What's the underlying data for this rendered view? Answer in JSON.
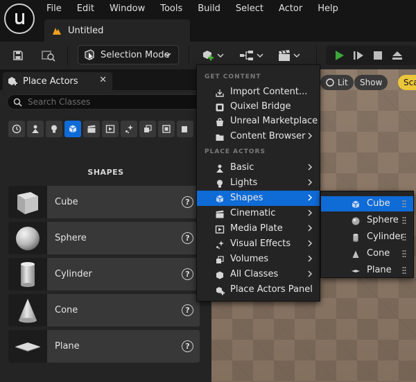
{
  "menubar": {
    "items": [
      "File",
      "Edit",
      "Window",
      "Tools",
      "Build",
      "Select",
      "Actor",
      "Help"
    ],
    "document_tab": "Untitled"
  },
  "toolbar": {
    "mode_label": "Selection Mode"
  },
  "viewport": {
    "lit_label": "Lit",
    "show_label": "Show",
    "scale_label": "Sca"
  },
  "place_actors": {
    "tab_label": "Place Actors",
    "search_placeholder": "Search Classes",
    "category_header": "SHAPES",
    "items": [
      {
        "label": "Cube",
        "icon": "cube-icon"
      },
      {
        "label": "Sphere",
        "icon": "sphere-icon"
      },
      {
        "label": "Cylinder",
        "icon": "cylinder-icon"
      },
      {
        "label": "Cone",
        "icon": "cone-icon"
      },
      {
        "label": "Plane",
        "icon": "plane-icon"
      }
    ]
  },
  "dropdown": {
    "get_content_header": "GET CONTENT",
    "place_actors_header": "PLACE ACTORS",
    "get_content": [
      "Import Content...",
      "Quixel Bridge",
      "Unreal Marketplace",
      "Content Browser"
    ],
    "place_actors": [
      "Basic",
      "Lights",
      "Shapes",
      "Cinematic",
      "Media Plate",
      "Visual Effects",
      "Volumes",
      "All Classes",
      "Place Actors Panel"
    ]
  },
  "submenu": {
    "items": [
      "Cube",
      "Sphere",
      "Cylinder",
      "Cone",
      "Plane"
    ]
  },
  "colors": {
    "accent": "#0f6bd6",
    "play": "#3ea83a",
    "scale_badge": "#ecc63a"
  }
}
